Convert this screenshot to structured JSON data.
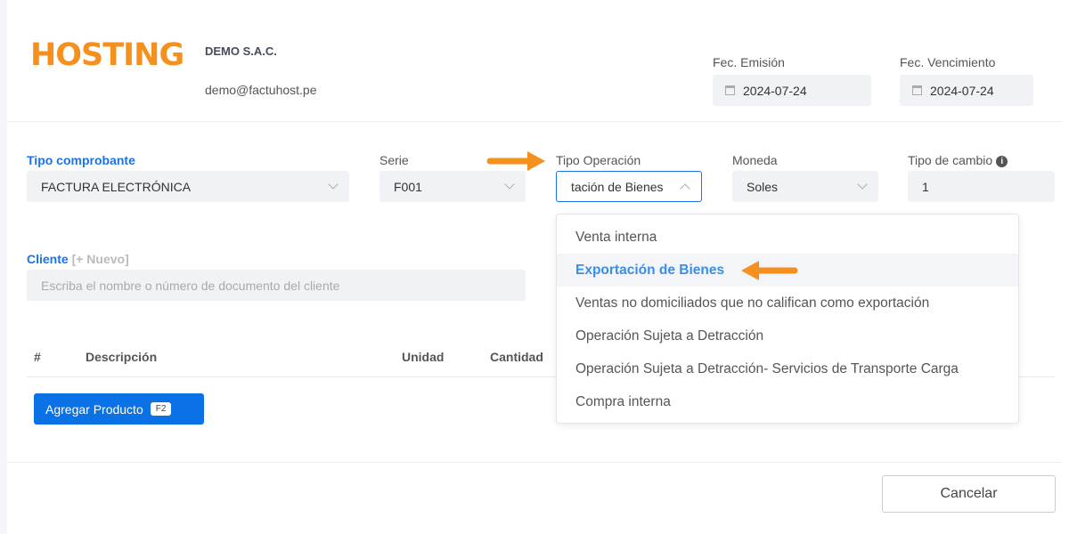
{
  "header": {
    "logo_text": "HOSTING",
    "company_name": "DEMO S.A.C.",
    "company_email": "demo@factuhost.pe",
    "fec_emision_label": "Fec. Emisión",
    "fec_emision_value": "2024-07-24",
    "fec_vencimiento_label": "Fec. Vencimiento",
    "fec_vencimiento_value": "2024-07-24"
  },
  "form": {
    "tipo_comprobante_label": "Tipo comprobante",
    "tipo_comprobante_value": "FACTURA ELECTRÓNICA",
    "serie_label": "Serie",
    "serie_value": "F001",
    "tipo_operacion_label": "Tipo Operación",
    "tipo_operacion_value": "tación de Bienes",
    "moneda_label": "Moneda",
    "moneda_value": "Soles",
    "tipo_cambio_label": "Tipo de cambio",
    "tipo_cambio_value": "1",
    "cliente_label": "Cliente",
    "cliente_nuevo": "[+ Nuevo]",
    "cliente_placeholder": "Escriba el nombre o número de documento del cliente"
  },
  "table": {
    "columns": [
      "#",
      "Descripción",
      "Unidad",
      "Cantidad"
    ]
  },
  "buttons": {
    "add_product": "Agregar Producto",
    "add_product_shortcut": "F2",
    "cancel": "Cancelar"
  },
  "dropdown": {
    "options": [
      "Venta interna",
      "Exportación de Bienes",
      "Ventas no domiciliados que no califican como exportación",
      "Operación Sujeta a Detracción",
      "Operación Sujeta a Detracción- Servicios de Transporte Carga",
      "Compra interna"
    ],
    "selected": "Exportación de Bienes"
  },
  "colors": {
    "accent": "#1a73e8",
    "brand": "#f5901e",
    "button_primary": "#0b72e5",
    "annotation_arrow": "#f5901e"
  }
}
